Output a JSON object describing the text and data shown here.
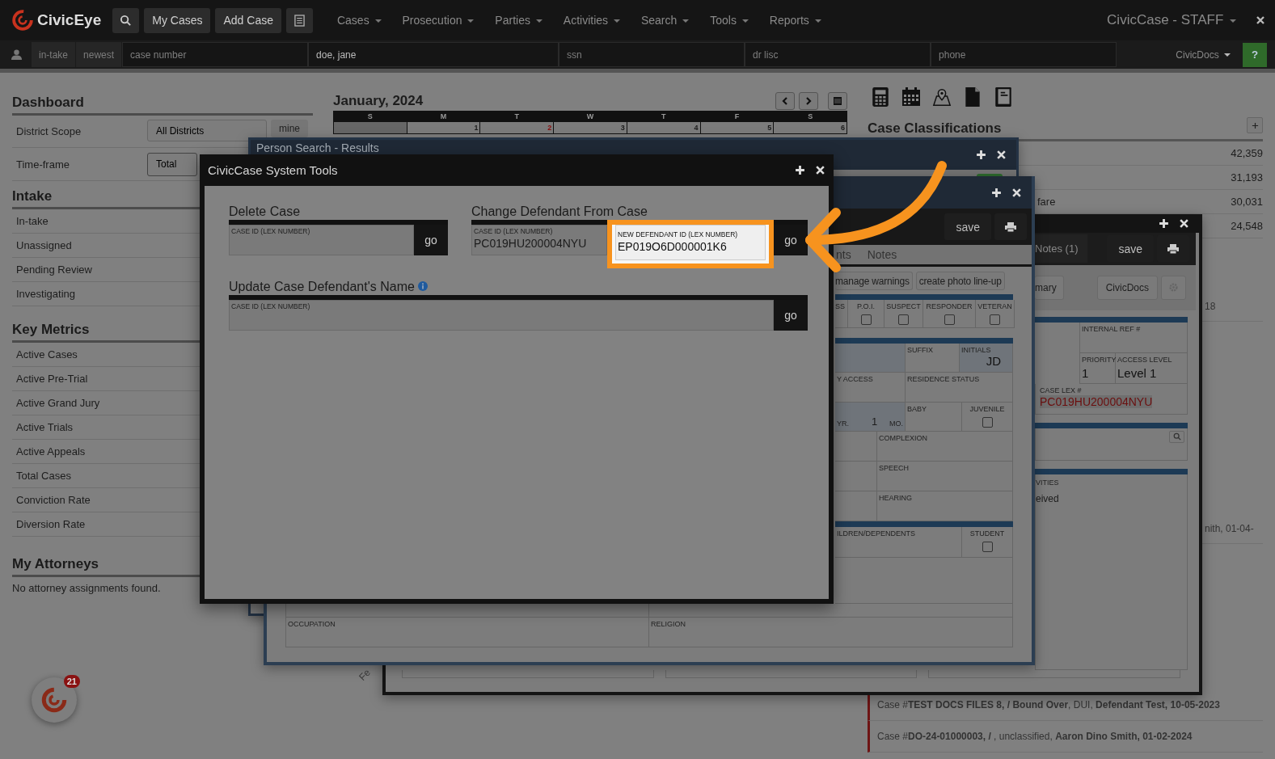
{
  "navbar": {
    "brand": "CivicEye",
    "buttons": [
      "My Cases",
      "Add Case"
    ],
    "menus": [
      "Cases",
      "Prosecution",
      "Parties",
      "Activities",
      "Search",
      "Tools",
      "Reports"
    ],
    "account": "CivicCase - STAFF"
  },
  "quick_search": {
    "filters": [
      "in-take",
      "newest"
    ],
    "fields": [
      {
        "placeholder": "case number"
      },
      {
        "value": "doe, jane"
      },
      {
        "placeholder": "ssn"
      },
      {
        "placeholder": "dr lisc"
      },
      {
        "placeholder": "phone"
      }
    ],
    "docs_menu": "CivicDocs",
    "help": "?"
  },
  "dashboard": {
    "title": "Dashboard",
    "scope": {
      "label": "District Scope",
      "value": "All Districts",
      "button": "mine"
    },
    "timeframe": {
      "label": "Time-frame",
      "value": "Total"
    },
    "sections": [
      {
        "title": "Intake",
        "items": [
          "In-take",
          "Unassigned",
          "Pending Review",
          "Investigating"
        ]
      },
      {
        "title": "Key Metrics",
        "items": [
          "Active Cases",
          "Active Pre-Trial",
          "Active Grand Jury",
          "Active Trials",
          "Active Appeals",
          "Total Cases",
          "Conviction Rate",
          "Diversion Rate"
        ]
      }
    ],
    "attorneys": {
      "title": "My Attorneys",
      "empty": "No attorney assignments found."
    }
  },
  "calendar": {
    "month": "January, 2024",
    "weekdays": [
      "S",
      "M",
      "T",
      "W",
      "T",
      "F",
      "S"
    ],
    "days": [
      {
        "blank": true
      },
      {
        "label": "1",
        "holiday": false
      },
      {
        "label": "2",
        "holiday": true
      },
      {
        "label": "3",
        "holiday": false
      },
      {
        "label": "4",
        "holiday": false
      },
      {
        "label": "5",
        "holiday": false
      },
      {
        "label": "6",
        "holiday": false
      }
    ],
    "rotated_label": "Fe"
  },
  "classifications": {
    "title": "Case Classifications",
    "rows": [
      {
        "value": "42,359"
      },
      {
        "value": "31,193"
      },
      {
        "label": "fare",
        "value": "30,031"
      },
      {
        "value": "24,548"
      }
    ]
  },
  "case_list": [
    {
      "kind": "partial",
      "text": "18"
    },
    {
      "kind": "partial",
      "text": "nith, 01-04-"
    },
    {
      "kind": "full",
      "text": "Case #**TEST DOCS FILES 8, / Bound Over**, DUI, **Defendant Test, 10-05-2023**"
    },
    {
      "kind": "full",
      "text": "Case #**DO-24-01000003, /** , unclassified, **Aaron Dino Smith, 01-02-2024**"
    }
  ],
  "search_results_window": {
    "title": "Person Search - Results"
  },
  "person_window": {
    "save": "save",
    "tabs": [
      {
        "label": "nts",
        "selected": false
      },
      {
        "label": "Notes",
        "selected": false
      }
    ],
    "buttons": [
      "manage warnings",
      "create photo line-up"
    ],
    "flags": [
      {
        "label": "SS"
      },
      {
        "label": "P.O.I.",
        "checked": false
      },
      {
        "label": "SUSPECT",
        "checked": false
      },
      {
        "label": "RESPONDER",
        "checked": false
      },
      {
        "label": "VETERAN",
        "checked": false
      }
    ],
    "suffix": "SUFFIX",
    "initials": {
      "label": "INITIALS",
      "value": "JD"
    },
    "access": "Y ACCESS",
    "residence": "RESIDENCE STATUS",
    "age": {
      "years_label": "YR.",
      "months": "1",
      "months_label": "MO."
    },
    "baby": "BABY",
    "juvenile": {
      "label": "JUVENILE",
      "checked": false
    },
    "complexion": "COMPLEXION",
    "speech": "SPEECH",
    "hearing": "HEARING",
    "dependents": "ILDREN/DEPENDENTS",
    "student": {
      "label": "STUDENT",
      "checked": false
    },
    "occupation": "OCCUPATION",
    "religion": "RELIGION"
  },
  "case_window": {
    "tab": "Notes (1)",
    "save": "save",
    "summary": "mary",
    "docs": "CivicDocs",
    "internal_ref": "INTERNAL REF #",
    "priority": {
      "label": "PRIORITY",
      "value": "1"
    },
    "access_level": {
      "label": "ACCESS LEVEL",
      "value": "Level 1"
    },
    "case_lex": {
      "label": "CASE LEX #",
      "value": "PC019HU200004NYU"
    },
    "activities": "VITIES",
    "activity_text": "eived"
  },
  "tools_window": {
    "title": "CivicCase System Tools",
    "delete": {
      "title": "Delete Case",
      "field_label": "CASE ID (LEX NUMBER)",
      "go": "go"
    },
    "change": {
      "title": "Change Defendant From Case",
      "case_label": "CASE ID (LEX NUMBER)",
      "case_value": "PC019HU200004NYU",
      "new_label": "NEW DEFENDANT ID (LEX NUMBER)",
      "new_value": "EP019O6D000001K6",
      "go": "go",
      "highlighted": true
    },
    "update": {
      "title": "Update Case Defendant's Name",
      "field_label": "CASE ID (LEX NUMBER)",
      "go": "go"
    }
  },
  "notification_badge": "21"
}
